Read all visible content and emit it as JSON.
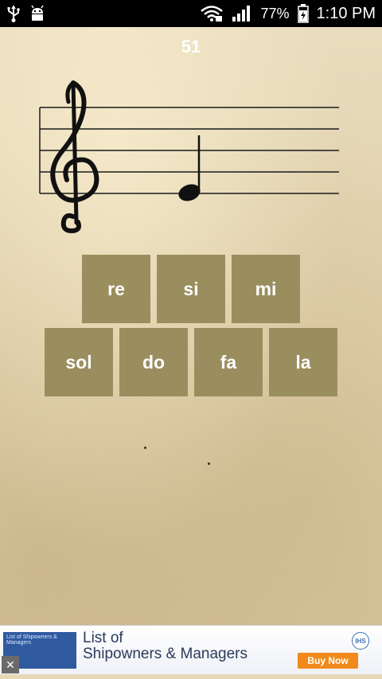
{
  "status_bar": {
    "usb_icon": "usb-icon",
    "android_icon": "android-debug-icon",
    "wifi_icon": "wifi-icon",
    "signal_icon": "cellular-signal-icon",
    "battery_percent": "77%",
    "battery_icon": "battery-charging-icon",
    "time": "1:10 PM"
  },
  "game": {
    "score": "51",
    "clef": "treble-clef",
    "note": "quarter-note"
  },
  "answers": {
    "row1": [
      "re",
      "si",
      "mi"
    ],
    "row2": [
      "sol",
      "do",
      "fa",
      "la"
    ]
  },
  "ad": {
    "thumbnail_text": "List of Shipowners & Managers",
    "title": "List of\nShipowners & Managers",
    "title_line1": "List of",
    "title_line2": "Shipowners & Managers",
    "badge": "IHS",
    "cta": "Buy Now",
    "close": "✕"
  },
  "colors": {
    "parchment": "#e6d9b8",
    "answer_button": "#9a8e5f",
    "ad_cta": "#f08a1c"
  }
}
